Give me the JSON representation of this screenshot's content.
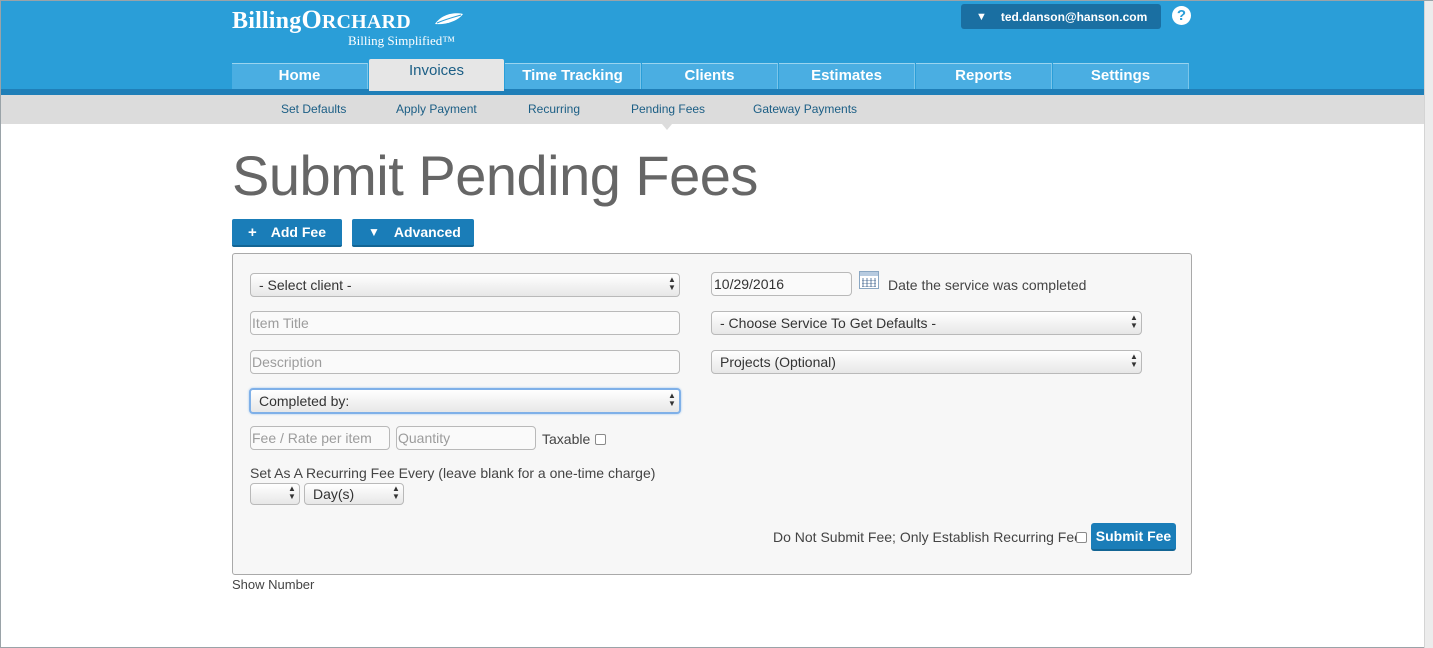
{
  "header": {
    "logo_main_1": "Billing",
    "logo_main_o": "O",
    "logo_main_2": "RCHARD",
    "logo_tagline": "Billing Simplified™",
    "user_email": "ted.danson@hanson.com",
    "help_label": "?"
  },
  "nav": {
    "tabs": [
      {
        "label": "Home"
      },
      {
        "label": "Invoices"
      },
      {
        "label": "Time Tracking"
      },
      {
        "label": "Clients"
      },
      {
        "label": "Estimates"
      },
      {
        "label": "Reports"
      },
      {
        "label": "Settings"
      }
    ],
    "active_tab": "Invoices"
  },
  "subnav": {
    "items": [
      {
        "label": "Set Defaults"
      },
      {
        "label": "Apply Payment"
      },
      {
        "label": "Recurring"
      },
      {
        "label": "Pending Fees"
      },
      {
        "label": "Gateway Payments"
      }
    ],
    "active_item": "Pending Fees"
  },
  "page": {
    "title": "Submit Pending Fees",
    "add_fee_label": "Add Fee",
    "advanced_label": "Advanced",
    "show_number_label": "Show Number"
  },
  "form": {
    "client_select": "- Select client -",
    "item_title_placeholder": "Item Title",
    "description_placeholder": "Description",
    "completed_by_select": "Completed by:",
    "fee_placeholder": "Fee / Rate per item",
    "quantity_placeholder": "Quantity",
    "taxable_label": "Taxable",
    "recurring_label": "Set As A Recurring Fee Every (leave blank for a one-time charge)",
    "recurring_count_select": "",
    "recurring_unit_select": "Day(s)",
    "date_value": "10/29/2016",
    "date_label": "Date the service was completed",
    "service_select": "- Choose Service To Get Defaults -",
    "projects_select": "Projects (Optional)",
    "no_submit_label": "Do Not Submit Fee; Only Establish Recurring Fee",
    "submit_label": "Submit Fee"
  },
  "colors": {
    "header_blue": "#2a9ed8",
    "button_blue": "#1a7db8",
    "subnav_gray": "#dcdcdc"
  }
}
